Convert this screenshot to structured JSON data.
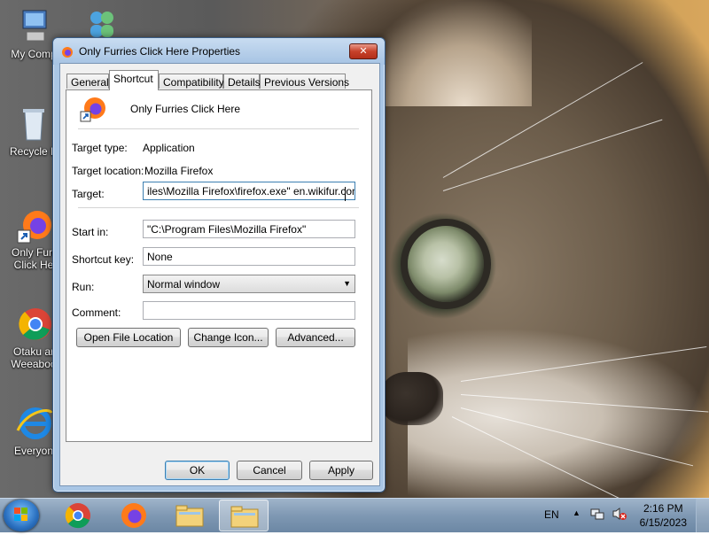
{
  "desktop": {
    "icons": [
      {
        "label": "My Comp"
      },
      {
        "label": "Recycle B"
      },
      {
        "label": "Only Furr Click He"
      },
      {
        "label": "Otaku ar Weeaboo"
      },
      {
        "label": "Everyon"
      }
    ]
  },
  "dialog": {
    "title": "Only Furries Click Here Properties",
    "close_label": "✕",
    "tabs": [
      {
        "label": "General"
      },
      {
        "label": "Shortcut"
      },
      {
        "label": "Compatibility"
      },
      {
        "label": "Details"
      },
      {
        "label": "Previous Versions"
      }
    ],
    "active_tab": "Shortcut",
    "name": "Only Furries Click Here",
    "target_type_label": "Target type:",
    "target_type_value": "Application",
    "target_location_label": "Target location:",
    "target_location_value": "Mozilla Firefox",
    "target_label": "Target:",
    "target_value": "iles\\Mozilla Firefox\\firefox.exe\" en.wikifur.com",
    "start_in_label": "Start in:",
    "start_in_value": "\"C:\\Program Files\\Mozilla Firefox\"",
    "shortcut_key_label": "Shortcut key:",
    "shortcut_key_value": "None",
    "run_label": "Run:",
    "run_value": "Normal window",
    "comment_label": "Comment:",
    "comment_value": "",
    "buttons": {
      "open_file_location": "Open File Location",
      "change_icon": "Change Icon...",
      "advanced": "Advanced..."
    },
    "footer": {
      "ok": "OK",
      "cancel": "Cancel",
      "apply": "Apply"
    }
  },
  "taskbar": {
    "language": "EN",
    "time": "2:16 PM",
    "date": "6/15/2023"
  }
}
